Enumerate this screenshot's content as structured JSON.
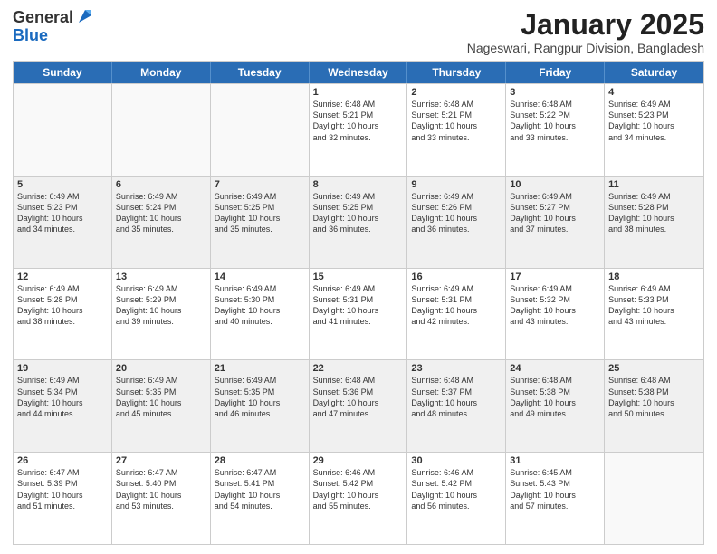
{
  "header": {
    "logo_general": "General",
    "logo_blue": "Blue",
    "title": "January 2025",
    "location": "Nageswari, Rangpur Division, Bangladesh"
  },
  "days_of_week": [
    "Sunday",
    "Monday",
    "Tuesday",
    "Wednesday",
    "Thursday",
    "Friday",
    "Saturday"
  ],
  "weeks": [
    [
      {
        "day": "",
        "info": ""
      },
      {
        "day": "",
        "info": ""
      },
      {
        "day": "",
        "info": ""
      },
      {
        "day": "1",
        "info": "Sunrise: 6:48 AM\nSunset: 5:21 PM\nDaylight: 10 hours\nand 32 minutes."
      },
      {
        "day": "2",
        "info": "Sunrise: 6:48 AM\nSunset: 5:21 PM\nDaylight: 10 hours\nand 33 minutes."
      },
      {
        "day": "3",
        "info": "Sunrise: 6:48 AM\nSunset: 5:22 PM\nDaylight: 10 hours\nand 33 minutes."
      },
      {
        "day": "4",
        "info": "Sunrise: 6:49 AM\nSunset: 5:23 PM\nDaylight: 10 hours\nand 34 minutes."
      }
    ],
    [
      {
        "day": "5",
        "info": "Sunrise: 6:49 AM\nSunset: 5:23 PM\nDaylight: 10 hours\nand 34 minutes."
      },
      {
        "day": "6",
        "info": "Sunrise: 6:49 AM\nSunset: 5:24 PM\nDaylight: 10 hours\nand 35 minutes."
      },
      {
        "day": "7",
        "info": "Sunrise: 6:49 AM\nSunset: 5:25 PM\nDaylight: 10 hours\nand 35 minutes."
      },
      {
        "day": "8",
        "info": "Sunrise: 6:49 AM\nSunset: 5:25 PM\nDaylight: 10 hours\nand 36 minutes."
      },
      {
        "day": "9",
        "info": "Sunrise: 6:49 AM\nSunset: 5:26 PM\nDaylight: 10 hours\nand 36 minutes."
      },
      {
        "day": "10",
        "info": "Sunrise: 6:49 AM\nSunset: 5:27 PM\nDaylight: 10 hours\nand 37 minutes."
      },
      {
        "day": "11",
        "info": "Sunrise: 6:49 AM\nSunset: 5:28 PM\nDaylight: 10 hours\nand 38 minutes."
      }
    ],
    [
      {
        "day": "12",
        "info": "Sunrise: 6:49 AM\nSunset: 5:28 PM\nDaylight: 10 hours\nand 38 minutes."
      },
      {
        "day": "13",
        "info": "Sunrise: 6:49 AM\nSunset: 5:29 PM\nDaylight: 10 hours\nand 39 minutes."
      },
      {
        "day": "14",
        "info": "Sunrise: 6:49 AM\nSunset: 5:30 PM\nDaylight: 10 hours\nand 40 minutes."
      },
      {
        "day": "15",
        "info": "Sunrise: 6:49 AM\nSunset: 5:31 PM\nDaylight: 10 hours\nand 41 minutes."
      },
      {
        "day": "16",
        "info": "Sunrise: 6:49 AM\nSunset: 5:31 PM\nDaylight: 10 hours\nand 42 minutes."
      },
      {
        "day": "17",
        "info": "Sunrise: 6:49 AM\nSunset: 5:32 PM\nDaylight: 10 hours\nand 43 minutes."
      },
      {
        "day": "18",
        "info": "Sunrise: 6:49 AM\nSunset: 5:33 PM\nDaylight: 10 hours\nand 43 minutes."
      }
    ],
    [
      {
        "day": "19",
        "info": "Sunrise: 6:49 AM\nSunset: 5:34 PM\nDaylight: 10 hours\nand 44 minutes."
      },
      {
        "day": "20",
        "info": "Sunrise: 6:49 AM\nSunset: 5:35 PM\nDaylight: 10 hours\nand 45 minutes."
      },
      {
        "day": "21",
        "info": "Sunrise: 6:49 AM\nSunset: 5:35 PM\nDaylight: 10 hours\nand 46 minutes."
      },
      {
        "day": "22",
        "info": "Sunrise: 6:48 AM\nSunset: 5:36 PM\nDaylight: 10 hours\nand 47 minutes."
      },
      {
        "day": "23",
        "info": "Sunrise: 6:48 AM\nSunset: 5:37 PM\nDaylight: 10 hours\nand 48 minutes."
      },
      {
        "day": "24",
        "info": "Sunrise: 6:48 AM\nSunset: 5:38 PM\nDaylight: 10 hours\nand 49 minutes."
      },
      {
        "day": "25",
        "info": "Sunrise: 6:48 AM\nSunset: 5:38 PM\nDaylight: 10 hours\nand 50 minutes."
      }
    ],
    [
      {
        "day": "26",
        "info": "Sunrise: 6:47 AM\nSunset: 5:39 PM\nDaylight: 10 hours\nand 51 minutes."
      },
      {
        "day": "27",
        "info": "Sunrise: 6:47 AM\nSunset: 5:40 PM\nDaylight: 10 hours\nand 53 minutes."
      },
      {
        "day": "28",
        "info": "Sunrise: 6:47 AM\nSunset: 5:41 PM\nDaylight: 10 hours\nand 54 minutes."
      },
      {
        "day": "29",
        "info": "Sunrise: 6:46 AM\nSunset: 5:42 PM\nDaylight: 10 hours\nand 55 minutes."
      },
      {
        "day": "30",
        "info": "Sunrise: 6:46 AM\nSunset: 5:42 PM\nDaylight: 10 hours\nand 56 minutes."
      },
      {
        "day": "31",
        "info": "Sunrise: 6:45 AM\nSunset: 5:43 PM\nDaylight: 10 hours\nand 57 minutes."
      },
      {
        "day": "",
        "info": ""
      }
    ]
  ]
}
